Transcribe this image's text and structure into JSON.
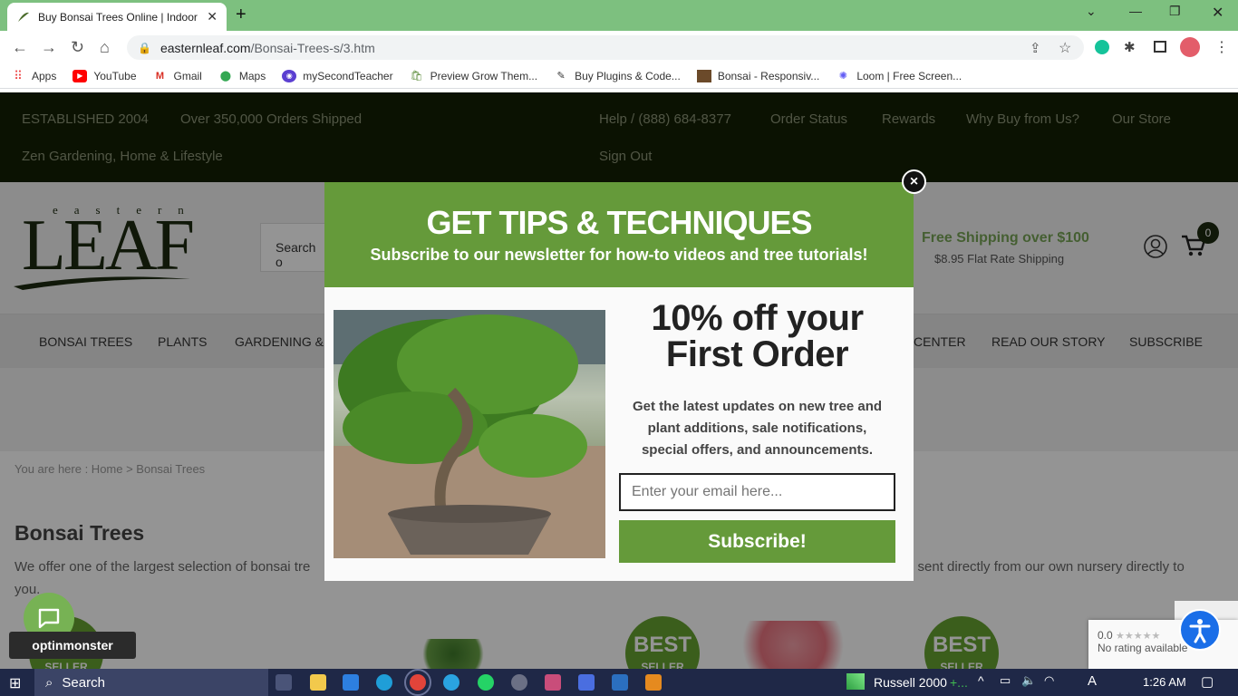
{
  "browser": {
    "tab_title": "Buy Bonsai Trees Online | Indoor",
    "new_tab": "+",
    "url_host": "easternleaf.com",
    "url_path": "/Bonsai-Trees-s/3.htm",
    "bookmarks": [
      {
        "label": "Apps",
        "icon": "apps-grid-icon"
      },
      {
        "label": "YouTube",
        "icon": "youtube-icon"
      },
      {
        "label": "Gmail",
        "icon": "gmail-icon"
      },
      {
        "label": "Maps",
        "icon": "maps-pin-icon"
      },
      {
        "label": "mySecondTeacher",
        "icon": "mysecondteacher-icon"
      },
      {
        "label": "Preview Grow Them...",
        "icon": "shopify-icon"
      },
      {
        "label": "Buy Plugins & Code...",
        "icon": "plugins-icon"
      },
      {
        "label": "Bonsai - Responsiv...",
        "icon": "bonsai-theme-icon"
      },
      {
        "label": "Loom | Free Screen...",
        "icon": "loom-icon"
      }
    ]
  },
  "topbar": {
    "established": "ESTABLISHED 2004",
    "orders": "Over 350,000 Orders Shipped",
    "tagline": "Zen Gardening, Home & Lifestyle",
    "help": "Help / (888) 684-8377",
    "order_status": "Order Status",
    "rewards": "Rewards",
    "why_buy": "Why Buy from Us?",
    "our_store": "Our Store",
    "sign_out": "Sign Out"
  },
  "header": {
    "logo_small": "eastern",
    "logo_big": "LEAF",
    "search_placeholder": "Search o",
    "shipping_title": "Free Shipping over $100",
    "shipping_sub": "$8.95 Flat Rate Shipping",
    "cart_count": "0"
  },
  "nav": {
    "items": [
      "BONSAI TREES",
      "PLANTS",
      "GARDENING &",
      "CENTER",
      "READ OUR STORY",
      "SUBSCRIBE"
    ]
  },
  "content": {
    "breadcrumb": "You are here : Home > Bonsai Trees",
    "title": "Bonsai Trees",
    "intro_left": "We offer one of the largest selection of bonsai tre",
    "intro_right": "e sent directly from our own nursery directly to",
    "intro_tail": "you.",
    "badge_best": "BEST",
    "badge_seller": "SELLER"
  },
  "popup": {
    "title": "GET TIPS & TECHNIQUES",
    "subtitle": "Subscribe to our newsletter for how-to videos and tree tutorials!",
    "offer_line1": "10% off your",
    "offer_line2": "First Order",
    "description": "Get the latest updates on new tree and plant additions, sale notifications, special offers, and announcements.",
    "email_placeholder": "Enter your email here...",
    "subscribe_label": "Subscribe!",
    "close_label": "×"
  },
  "widgets": {
    "optinmonster": "optinmonster",
    "rating_score": "0.0",
    "rating_stars": "★★★★★",
    "rating_text": "No rating available"
  },
  "taskbar": {
    "search": "Search",
    "ticker": "Russell 2000",
    "ticker_change": "+...",
    "time": "1:26 AM"
  },
  "colors": {
    "brand_green": "#659a3a",
    "topbar_bg": "#142004",
    "tabbar_bg": "#7dc07f"
  }
}
